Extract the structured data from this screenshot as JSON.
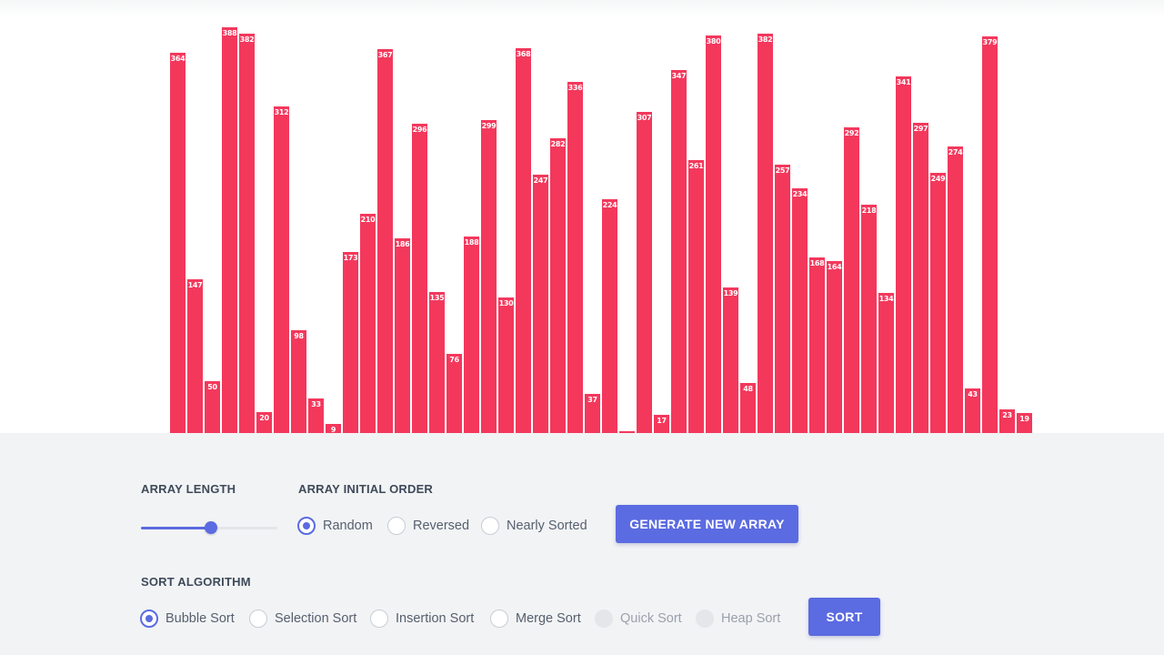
{
  "chart_data": {
    "type": "bar",
    "values": [
      364,
      147,
      50,
      388,
      382,
      20,
      312,
      98,
      33,
      9,
      173,
      210,
      367,
      186,
      296,
      135,
      76,
      188,
      299,
      130,
      368,
      247,
      282,
      336,
      37,
      224,
      2,
      307,
      17,
      347,
      261,
      380,
      139,
      48,
      382,
      257,
      234,
      168,
      164,
      292,
      218,
      134,
      341,
      297,
      249,
      274,
      43,
      379,
      23,
      19
    ],
    "bar_color": "#f3385c",
    "label_color": "#ffffff"
  },
  "controls": {
    "array_length": {
      "label": "ARRAY LENGTH",
      "fraction": 0.51
    },
    "initial_order": {
      "label": "ARRAY INITIAL ORDER",
      "options": [
        "Random",
        "Reversed",
        "Nearly Sorted"
      ],
      "selected": "Random"
    },
    "generate_button": "GENERATE NEW ARRAY",
    "sort_algorithm": {
      "label": "SORT ALGORITHM",
      "options": [
        "Bubble Sort",
        "Selection Sort",
        "Insertion Sort",
        "Merge Sort",
        "Quick Sort",
        "Heap Sort"
      ],
      "selected": "Bubble Sort",
      "disabled": [
        "Quick Sort",
        "Heap Sort"
      ]
    },
    "sort_button": "SORT"
  },
  "colors": {
    "accent": "#5b6be1",
    "panel_background": "#f2f3f5",
    "text": "#3e4a59"
  }
}
